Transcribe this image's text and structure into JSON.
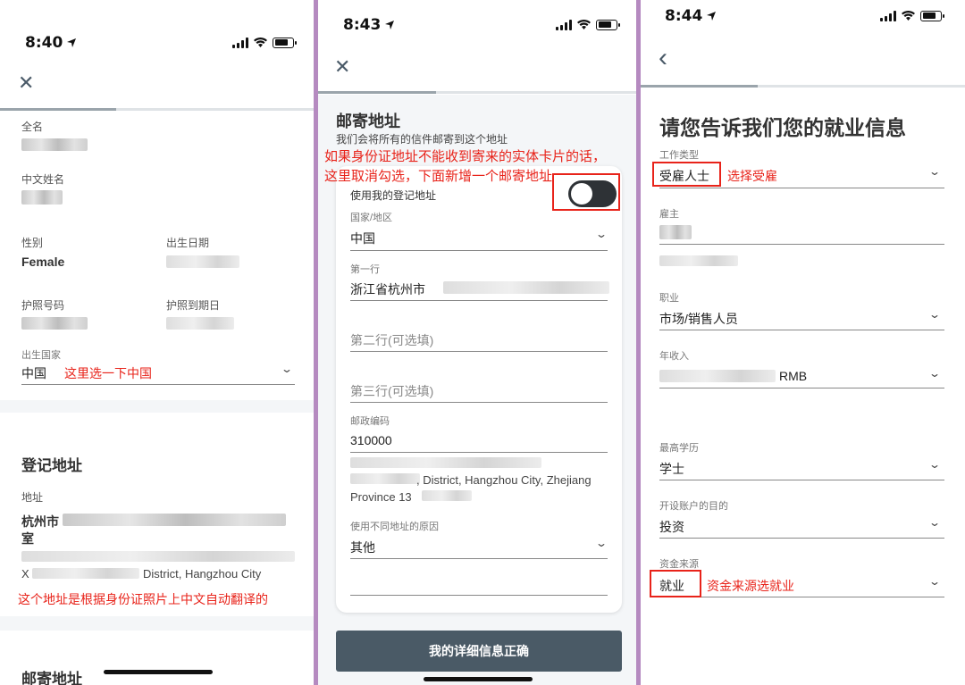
{
  "panel1": {
    "time": "8:40",
    "fields": {
      "full_name_label": "全名",
      "chinese_name_label": "中文姓名",
      "gender_label": "性别",
      "gender_value": "Female",
      "dob_label": "出生日期",
      "passport_no_label": "护照号码",
      "passport_expiry_label": "护照到期日",
      "birth_country_label": "出生国家",
      "birth_country_value": "中国",
      "birth_country_note": "这里选一下中国"
    },
    "registered_address": {
      "title": "登记地址",
      "address_label": "地址",
      "line1": "杭州市",
      "line1b": "室",
      "line2_prefix": "X",
      "line2": "District, Hangzhou City",
      "note": "这个地址是根据身份证照片上中文自动翻译的"
    },
    "mailing_title": "邮寄地址"
  },
  "panel2": {
    "time": "8:43",
    "title": "邮寄地址",
    "subtitle": "我们会将所有的信件邮寄到这个地址",
    "note_line1": "如果身份证地址不能收到寄来的实体卡片的话，",
    "note_line2": "这里取消勾选，下面新增一个邮寄地址",
    "use_registered_label": "使用我的登记地址",
    "country_label": "国家/地区",
    "country_value": "中国",
    "line1_label": "第一行",
    "line1_value": "浙江省杭州市",
    "line2_placeholder": "第二行(可选填)",
    "line3_placeholder": "第三行(可选填)",
    "postcode_label": "邮政编码",
    "postcode_value": "310000",
    "translated_line1": ", District, Hangzhou City, Zhejiang",
    "translated_line2": "Province 13",
    "reason_label": "使用不同地址的原因",
    "reason_value": "其他",
    "confirm_button": "我的详细信息正确"
  },
  "panel3": {
    "time": "8:44",
    "title": "请您告诉我们您的就业信息",
    "job_type_label": "工作类型",
    "job_type_value": "受雇人士",
    "job_type_note": "选择受雇",
    "employer_label": "雇主",
    "occupation_label": "职业",
    "occupation_value": "市场/销售人员",
    "income_label": "年收入",
    "income_value": "RMB",
    "education_label": "最高学历",
    "education_value": "学士",
    "purpose_label": "开设账户的目的",
    "purpose_value": "投资",
    "funds_label": "资金来源",
    "funds_value": "就业",
    "funds_note": "资金来源选就业"
  },
  "icons": {
    "close": "✕",
    "back": "‹",
    "chevron": "⌄"
  },
  "colors": {
    "annotation_red": "#e8231a",
    "button_bg": "#4a5a66",
    "separator_purple": "#b58ac0"
  }
}
